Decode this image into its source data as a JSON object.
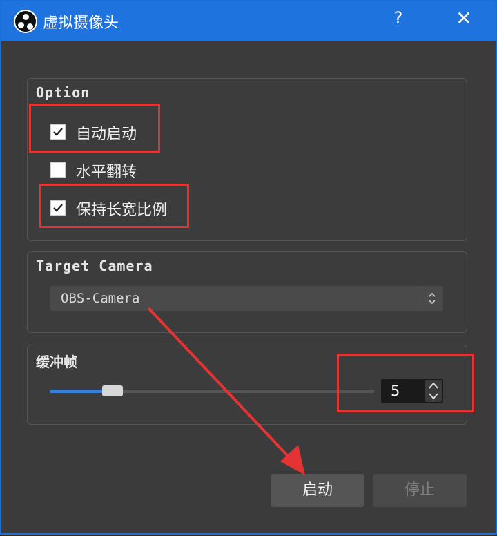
{
  "window": {
    "title": "虚拟摄像头",
    "help_label": "?",
    "close_label": "✕"
  },
  "option_group": {
    "legend": "Option",
    "checkboxes": [
      {
        "label": "自动启动",
        "checked": true
      },
      {
        "label": "水平翻转",
        "checked": false
      },
      {
        "label": "保持长宽比例",
        "checked": true
      }
    ]
  },
  "target_group": {
    "legend": "Target Camera",
    "selected": "OBS-Camera"
  },
  "buffer_group": {
    "legend": "缓冲帧",
    "slider_value": 5,
    "slider_fraction": 0.19,
    "spin_value": "5"
  },
  "buttons": {
    "start": "启动",
    "stop": "停止"
  },
  "colors": {
    "titlebar": "#1f73df",
    "accent": "#3d7fd6",
    "highlight": "#e53333"
  }
}
